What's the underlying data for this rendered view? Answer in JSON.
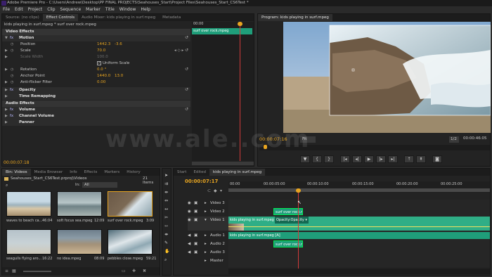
{
  "window": {
    "title": "Adobe Premiere Pro - C:\\Users\\Andrew\\Desktop\\PP FINAL PROJECTS\\Seahouses_Start\\Project Files\\Seahouses_Start_CS6Test *"
  },
  "menu": [
    "File",
    "Edit",
    "Project",
    "Clip",
    "Sequence",
    "Marker",
    "Title",
    "Window",
    "Help"
  ],
  "effect_controls": {
    "tabs": [
      "Source: (no clips)",
      "Effect Controls",
      "Audio Mixer: kids playing in surf.mpeg",
      "Metadata"
    ],
    "breadcrumb": "kids playing in surf.mpeg * surf over rock.mpeg",
    "ruler_time": "00:00",
    "mini_clip_label": "surf over rock.mpeg",
    "section_video": "Video Effects",
    "section_audio": "Audio Effects",
    "motion": "Motion",
    "props": {
      "position": {
        "label": "Position",
        "x": "1442.3",
        "y": "-3.6"
      },
      "scale": {
        "label": "Scale",
        "value": "70.0"
      },
      "scale_width": {
        "label": "Scale Width",
        "value": "100.0"
      },
      "uniform_scale": "Uniform Scale",
      "rotation": {
        "label": "Rotation",
        "value": "0.0 °"
      },
      "anchor": {
        "label": "Anchor Point",
        "x": "1440.0",
        "y": "13.0"
      },
      "antiflicker": {
        "label": "Anti-flicker Filter",
        "value": "0.00"
      }
    },
    "fx": [
      "Opacity",
      "Time Remapping"
    ],
    "audio_fx": [
      "Volume",
      "Channel Volume",
      "Panner"
    ],
    "timecode": "00:00:07:18"
  },
  "program": {
    "tab": "Program: kids playing in surf.mpeg",
    "timecode": "00:00:07:16",
    "fit": "Fit",
    "ratio": "1/2",
    "duration": "00:00:46:05"
  },
  "project": {
    "tabs": [
      "Bin: Videos",
      "Media Browser",
      "Info",
      "Effects",
      "Markers",
      "History"
    ],
    "path": "Seahouses_Start_CS6Test.prproj\\Videos",
    "items_count": "21 Items",
    "in_label": "In:",
    "in_value": "All",
    "clips": [
      {
        "name": "waves to beach ca...",
        "dur": "46:04"
      },
      {
        "name": "soft focus sea.mpeg",
        "dur": "12:09"
      },
      {
        "name": "surf over rock.mpeg",
        "dur": "3:09"
      },
      {
        "name": "seagulls flying aro...",
        "dur": "16:22"
      },
      {
        "name": "no idea.mpeg",
        "dur": "08:09"
      },
      {
        "name": "pebbles close.mpeg",
        "dur": "59:21"
      }
    ]
  },
  "timeline": {
    "tabs": [
      "Start",
      "Edited",
      "kids playing in surf.mpeg"
    ],
    "timecode": "00:00:07:17",
    "ruler": [
      "00:00",
      "00:00:05:00",
      "00:00:10:00",
      "00:00:15:00",
      "00:00:20:00",
      "00:00:25:00"
    ],
    "tracks": [
      "Video 3",
      "Video 2",
      "Video 1",
      "Audio 1",
      "Audio 2",
      "Audio 3",
      "Master"
    ],
    "clips": {
      "v2": "surf over rock.mp",
      "v1_a": "kids playing in surf.mpeg [V]",
      "v1_b": "Opacity:Opacity ▾",
      "a1": "kids playing in surf.mpeg [A]",
      "a2": "surf over rock.mp"
    }
  },
  "watermark": "www.ale..com"
}
